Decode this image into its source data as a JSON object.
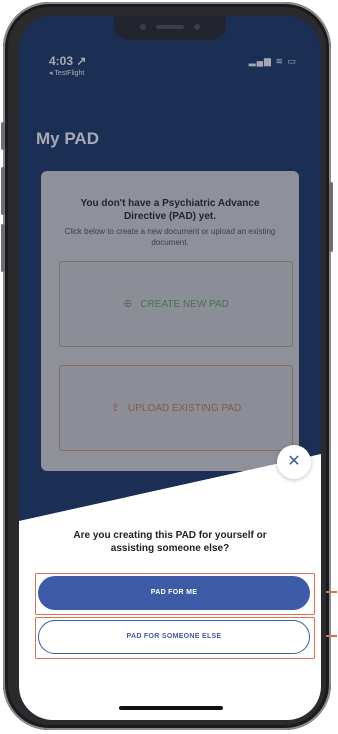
{
  "status_bar": {
    "time": "4:03 ↗",
    "back_app": "◂ TestFlight",
    "icons": "▂▄▆ ≋ ▭"
  },
  "page": {
    "title": "My PAD"
  },
  "card": {
    "heading": "You don't have a Psychiatric Advance Directive (PAD) yet.",
    "subtext": "Click below to create a new document or upload an existing document.",
    "create_label": "CREATE NEW PAD",
    "upload_label": "UPLOAD EXISTING PAD"
  },
  "icons": {
    "create": "⊕",
    "upload": "⇪",
    "close": "✕"
  },
  "sheet": {
    "question": "Are you creating this PAD for yourself or assisting someone else?",
    "primary_label": "PAD FOR ME",
    "secondary_label": "PAD FOR SOMEONE ELSE"
  },
  "colors": {
    "header_blue": "#1f3a6b",
    "primary_blue": "#3d5ba6",
    "highlight_orange": "#d9704f",
    "create_green": "#6da266",
    "upload_orange": "#c77a57"
  }
}
